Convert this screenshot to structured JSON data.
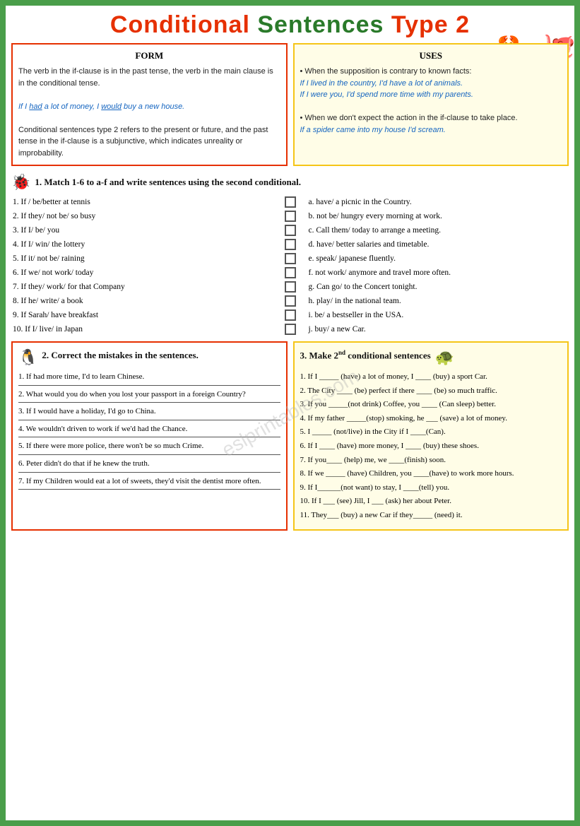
{
  "title": {
    "text": "Conditional Sentences Type 2"
  },
  "form_box": {
    "title": "FORM",
    "content1": "The verb in the if-clause is in the past tense, the verb in the main clause is in the conditional tense.",
    "example1": "If I had a lot of money, I would buy a new house.",
    "content2": "Conditional sentences type 2 refers to the present or future, and the past tense in the if-clause is a subjunctive, which indicates unreality or improbability."
  },
  "uses_box": {
    "title": "USES",
    "bullet1": "When the supposition is contrary to known facts:",
    "example1": "If I lived in the country, I'd have a lot of animals.",
    "example2": "If I were you, I'd spend more time with my parents.",
    "bullet2": "When we don't expect the action in the if-clause to take place.",
    "example3": "If a spider came into my house I'd scream."
  },
  "exercise1": {
    "header": "1. Match 1-6 to a-f and write sentences using the second conditional.",
    "left_items": [
      "1. If / be/better at tennis",
      "2. If they/ not be/ so busy",
      "3. If I/ be/ you",
      "4. If I/ win/ the lottery",
      "5. If it/ not be/ raining",
      "6. If we/ not work/ today",
      "7. If they/ work/ for that Company",
      "8. If he/ write/ a book",
      "9. If Sarah/ have breakfast",
      "10. If I/ live/ in Japan"
    ],
    "right_items": [
      "a. have/ a picnic in the Country.",
      "b. not be/ hungry every morning at work.",
      "c. Call them/ today to arrange a meeting.",
      "d. have/ better salaries and timetable.",
      "e. speak/ japanese fluently.",
      "f. not work/ anymore and travel more often.",
      "g. Can go/ to the Concert tonight.",
      "h. play/ in the national team.",
      "i. be/ a bestseller in the USA.",
      "j. buy/ a new Car."
    ]
  },
  "exercise2": {
    "header": "2. Correct the mistakes in the sentences.",
    "items": [
      "1. If had more time, I'd to learn Chinese.",
      "2. What would you do when you lost your passport in a foreign Country?",
      "3. If I would have a holiday, I'd go to China.",
      "4. We wouldn't driven to work if we'd had the Chance.",
      "5. If there were more police, there won't be so much Crime.",
      "6. Peter didn't do that if he knew the truth.",
      "7. If my Children would eat a lot of sweets, they'd visit the dentist more often."
    ]
  },
  "exercise3": {
    "header": "3. Make 2",
    "header2": "nd",
    "header3": " conditional sentences",
    "items": [
      "1. If I _____ (have) a lot of money, I ____ (buy) a sport Car.",
      "2. The City ____ (be) perfect if there ____ (be) so much traffic.",
      "3. If you _____(not drink) Coffee, you ____ (Can sleep) better.",
      "4. If my father _____(stop) smoking, he ___ (save) a lot of money.",
      "5. I _____ (not/live) in the City if I ____(Can).",
      "6. If I ____ (have) more money, I ____ (buy) these shoes.",
      "7. If you____ (help) me, we ____(finish) soon.",
      "8. If we _____ (have) Children, you ____(have) to work more hours.",
      "9. If I______(not want) to stay, I ____(tell) you.",
      "10. If I ___ (see) Jill, I ___ (ask) her about Peter.",
      "11. They___ (buy) a new Car if they_____ (need) it."
    ]
  },
  "watermark": "eslprintables.com"
}
